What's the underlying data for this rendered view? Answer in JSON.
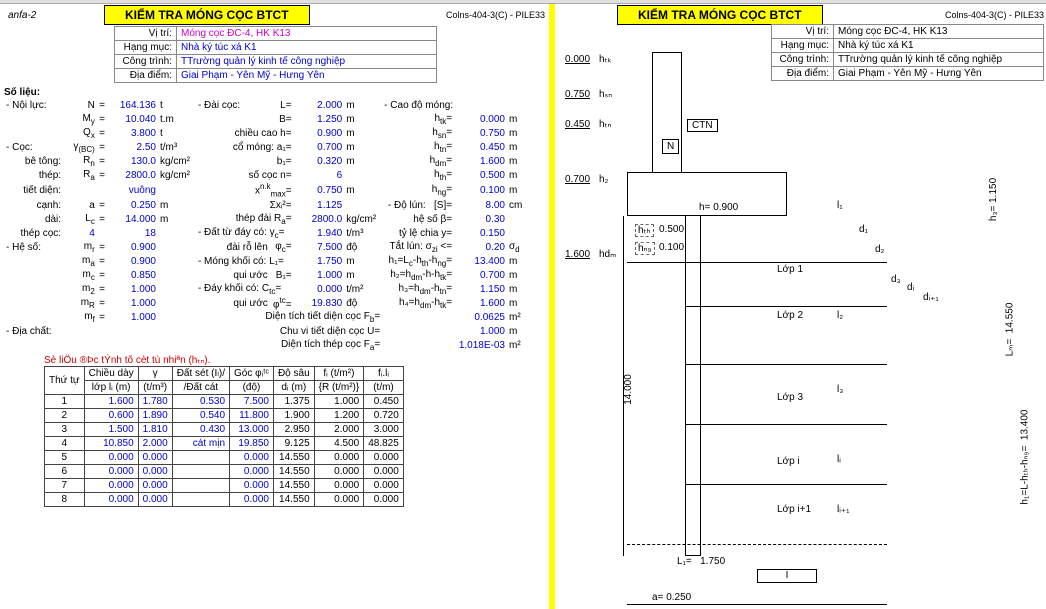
{
  "anfa": "anfa-2",
  "title": "KIỂM TRA MÓNG CỌC BTCT",
  "ref": "Colns-404-3(C) - PILE33",
  "info": {
    "vitri_lbl": "Vị trí:",
    "vitri": "Móng cọc ĐC-4, HK K13",
    "hangmuc_lbl": "Hạng mục:",
    "hangmuc": "Nhà ký túc xá K1",
    "congtrinh_lbl": "Công trình:",
    "congtrinh": "TTrường quản lý kinh tế công nghiệp",
    "diadiem_lbl": "Địa điểm:",
    "diadiem": "Giai Phạm - Yên Mỹ - Hưng Yên"
  },
  "so_lieu_lbl": "Số liệu:",
  "rows": {
    "noi_luc_lbl": "- Nội lực:",
    "N_lbl": "N",
    "N_val": "164.136",
    "N_unit": "t",
    "dai_coc_lbl": "- Đài cọc:",
    "L_lbl": "L=",
    "L_val": "2.000",
    "L_unit": "m",
    "cao_do_mong_lbl": "- Cao độ móng:",
    "My_lbl": "M",
    "My_sub": "y",
    "My_val": "10.040",
    "My_unit": "t.m",
    "B_lbl": "B=",
    "B_val": "1.250",
    "B_unit": "m",
    "htk_lbl": "h",
    "htk_sub": "tk",
    "htk_val": "0.000",
    "htk_unit": "m",
    "Qx_lbl": "Q",
    "Qx_sub": "x",
    "Qx_val": "3.800",
    "Qx_unit": "t",
    "chieucao_lbl": "chiều cao h=",
    "h_val": "0.900",
    "h_unit": "m",
    "han_lbl": "h",
    "han_sub": "sn",
    "han_val": "0.750",
    "han_unit": "m",
    "coc_lbl": "- Cọc:",
    "gbc_lbl": "γ",
    "gbc_sub": "(BC)",
    "gbc_val": "2.50",
    "gbc_unit": "t/m³",
    "cormong_lbl": "cổ móng: a₁=",
    "a1_val": "0.700",
    "a1_unit": "m",
    "htn_lbl": "h",
    "htn_sub": "tn",
    "htn_val": "0.450",
    "htn_unit": "m",
    "betong_lbl": "bê tông:",
    "Rn_lbl": "R",
    "Rn_sub": "n",
    "Rn_val": "130.0",
    "Rn_unit": "kg/cm²",
    "b1_lbl": "b₁=",
    "b1_val": "0.320",
    "b1_unit": "m",
    "hdm_lbl": "h",
    "hdm_sub": "dm",
    "hdm_val": "1.600",
    "hdm_unit": "m",
    "thep_lbl": "thép:",
    "Ra_lbl": "R",
    "Ra_sub": "a",
    "Ra_val": "2800.0",
    "Ra_unit": "kg/cm²",
    "socoen_lbl": "số cọc n=",
    "n_val": "6",
    "hth_lbl": "h",
    "hth_sub": "th",
    "hth_val": "0.500",
    "hth_unit": "m",
    "tietdien_lbl": "tiết diện:",
    "tietdien_val": "vuông",
    "xnk_lbl": "x",
    "xnk_sup": "n.k",
    "xnk_sub": "max",
    "xnk_val": "0.750",
    "xnk_unit": "m",
    "hng_lbl": "h",
    "hng_sub": "ng",
    "hng_val": "0.100",
    "hng_unit": "m",
    "canh_lbl": "cạnh:",
    "a_lbl": "a",
    "a_val": "0.250",
    "a_unit": "m",
    "sigx_lbl": "Σxᵢ²=",
    "sigx_val": "1.125",
    "dolun_lbl": "- Độ lún:",
    "S_lbl": "[S]=",
    "S_val": "8.00",
    "S_unit": "cm",
    "dai_lbl": "dài:",
    "Lc_lbl": "L",
    "Lc_sub": "c",
    "Lc_val": "14.000",
    "Lc_unit": "m",
    "thepdai_lbl": "thép đài R",
    "thepdai_sub": "a",
    "thepdai_val": "2800.0",
    "thepdai_unit": "kg/cm²",
    "heso_b_lbl": "hệ số β=",
    "beta_val": "0.30",
    "thepcoc_lbl": "thép cọc:",
    "thepcoc_n": "4",
    "thepcoc_d": "18",
    "dattu_lbl": "- Đất từ đáy có: γ",
    "gc_sub": "c",
    "gc_val": "1.940",
    "gc_unit": "t/m³",
    "tyle_lbl": "tỷ lệ chia y=",
    "y_val": "0.150",
    "heso_lbl": "- Hệ số:",
    "mr_lbl": "m",
    "mr_sub": "r",
    "mr_val": "0.900",
    "dairo_lbl": "đài rỗ lên",
    "phic_lbl": "φ",
    "phic_sub": "c",
    "phic_val": "7.500",
    "phic_unit": "độ",
    "tatlun_lbl": "Tắt lún: σ",
    "sigzi_sub": "zi",
    "sigzi_lt": "<=",
    "sigzi_val": "0.20",
    "sigd_lbl": "σ",
    "sigd_sub": "d",
    "ma_lbl": "m",
    "ma_sub": "a",
    "ma_val": "0.900",
    "mongkhoi_lbl": "- Móng khối có: L₁=",
    "L1_val": "1.750",
    "L1_unit": "m",
    "h1eq_lbl": "h₁=L",
    "h1eq_sub": "c",
    "h1eq_rest": "-h",
    "h1eq_sub2": "th",
    "h1eq_rest2": "-h",
    "h1eq_sub3": "ng",
    "h1_val": "13.400",
    "h1_unit": "m",
    "mc_lbl": "m",
    "mc_sub": "c",
    "mc_val": "0.850",
    "quiuoc_lbl": "qui ước",
    "Bq_lbl": "B₁=",
    "Bq_val": "1.000",
    "Bq_unit": "m",
    "h2eq_lbl": "h₂=h",
    "h2eq_sub": "dm",
    "h2eq_rest": "-h-h",
    "h2eq_sub2": "tk",
    "h2_val": "0.700",
    "h2_unit": "m",
    "m2_lbl": "m",
    "m2_sub": "2",
    "m2_val": "1.000",
    "daykhoi_lbl": "- Đáy khối có: C",
    "Ctc_sub": "tc",
    "Ctc_val": "0.000",
    "Ctc_unit": "t/m²",
    "h3eq_lbl": "h₃=h",
    "h3eq_sub": "dm",
    "h3eq_rest": "-h",
    "h3eq_sub2": "tn",
    "h3_val": "1.150",
    "h3_unit": "m",
    "mR_lbl": "m",
    "mR_sub": "R",
    "mR_val": "1.000",
    "quiuoc2_lbl": "qui ước",
    "phitc_lbl": "φ",
    "phitc_sup": "tc",
    "phitc_val": "19.830",
    "phitc_unit": "độ",
    "h4eq_lbl": "h₄=h",
    "h4eq_sub": "dm",
    "h4eq_rest": "-h",
    "h4eq_sub2": "tk",
    "h4_val": "1.600",
    "h4_unit": "m",
    "mf_lbl": "m",
    "mf_sub": "f",
    "mf_val": "1.000",
    "dt_tiet_lbl": "Diện tích tiết diện cọc F",
    "Fb_sub": "b",
    "Fb_val": "0.0625",
    "Fb_unit": "m²",
    "diachat_lbl": "- Địa chất:",
    "chuvi_lbl": "Chu vi tiết diện cọc U=",
    "U_val": "1.000",
    "U_unit": "m",
    "dtthep_lbl": "Diện tích thép cọc F",
    "Fa_sub": "a",
    "Fa_val": "1.018E-03",
    "Fa_unit": "m²"
  },
  "red_note": "Sè liÖu ®Þc tÝnh tõ cèt tù nhiªn (hₜₙ).",
  "table": {
    "h1": "Thứ tự",
    "h2a": "Chiều dày",
    "h2b": "lớp lᵢ (m)",
    "h3a": "γ",
    "h3b": "(t/m³)",
    "h4a": "Đất sét (Iₗ)/",
    "h4b": "/Đất cát",
    "h5a": "Góc φᵢᵗᶜ",
    "h5b": "(độ)",
    "h6a": "Độ sâu",
    "h6b": "dᵢ (m)",
    "h7a": "fᵢ (t/m²)",
    "h7b": "{R (t/m²)}",
    "h8a": "fᵢ.lᵢ",
    "h8b": "(t/m)",
    "rows": [
      {
        "n": "1",
        "l": "1.600",
        "g": "1.780",
        "d": "0.530",
        "phi": "7.500",
        "ds": "1.375",
        "f": "1.000",
        "fl": "0.450"
      },
      {
        "n": "2",
        "l": "0.600",
        "g": "1.890",
        "d": "0.540",
        "phi": "11.800",
        "ds": "1.900",
        "f": "1.200",
        "fl": "0.720"
      },
      {
        "n": "3",
        "l": "1.500",
        "g": "1.810",
        "d": "0.430",
        "phi": "13.000",
        "ds": "2.950",
        "f": "2.000",
        "fl": "3.000"
      },
      {
        "n": "4",
        "l": "10.850",
        "g": "2.000",
        "d": "cát mịn",
        "phi": "19.850",
        "ds": "9.125",
        "f": "4.500",
        "fl": "48.825"
      },
      {
        "n": "5",
        "l": "0.000",
        "g": "0.000",
        "d": "",
        "phi": "0.000",
        "ds": "14.550",
        "f": "0.000",
        "fl": "0.000"
      },
      {
        "n": "6",
        "l": "0.000",
        "g": "0.000",
        "d": "",
        "phi": "0.000",
        "ds": "14.550",
        "f": "0.000",
        "fl": "0.000"
      },
      {
        "n": "7",
        "l": "0.000",
        "g": "0.000",
        "d": "",
        "phi": "0.000",
        "ds": "14.550",
        "f": "0.000",
        "fl": "0.000"
      },
      {
        "n": "8",
        "l": "0.000",
        "g": "0.000",
        "d": "",
        "phi": "0.000",
        "ds": "14.550",
        "f": "0.000",
        "fl": "0.000"
      }
    ]
  },
  "diagram": {
    "htk": "0.000",
    "htk_lbl": "hₜₖ",
    "hsn": "0.750",
    "hsn_lbl": "hₛₙ",
    "htn": "0.450",
    "htn_lbl": "hₜₙ",
    "N": "N",
    "h2": "0.700",
    "h2_lbl": "h₂",
    "CTN": "CTN",
    "h_lbl": "h=",
    "h_val": "0.900",
    "hth_lbl": "hₜₕ",
    "hth_val": "0.500",
    "hng_lbl": "hₙ₉",
    "hng_val": "0.100",
    "hdm": "1.600",
    "hdm_lbl": "hdₘ",
    "Lop1": "Lớp 1",
    "Lop2": "Lớp 2",
    "Lop3": "Lớp 3",
    "Lopi": "Lớp i",
    "Lopi1": "Lớp i+1",
    "L14": "14.000",
    "L1_lbl": "L₁=",
    "L1_val": "1.750",
    "I": "I",
    "a_lbl": "a=",
    "a_val": "0.250",
    "rdim": {
      "h3": "1.150",
      "h1_eq": "h₁=L-hₜₕ-hₙ₉=",
      "h1_val": "13.400",
      "Lm": "Lₘ=",
      "Lm_val": "14.550",
      "d1": "d₁",
      "d2": "d₂",
      "d3": "d₃",
      "di": "dᵢ",
      "di1": "dᵢ₊₁",
      "l1": "l₁",
      "l2": "l₂",
      "l3": "l₃",
      "li": "lᵢ",
      "li1": "lᵢ₊₁"
    }
  }
}
